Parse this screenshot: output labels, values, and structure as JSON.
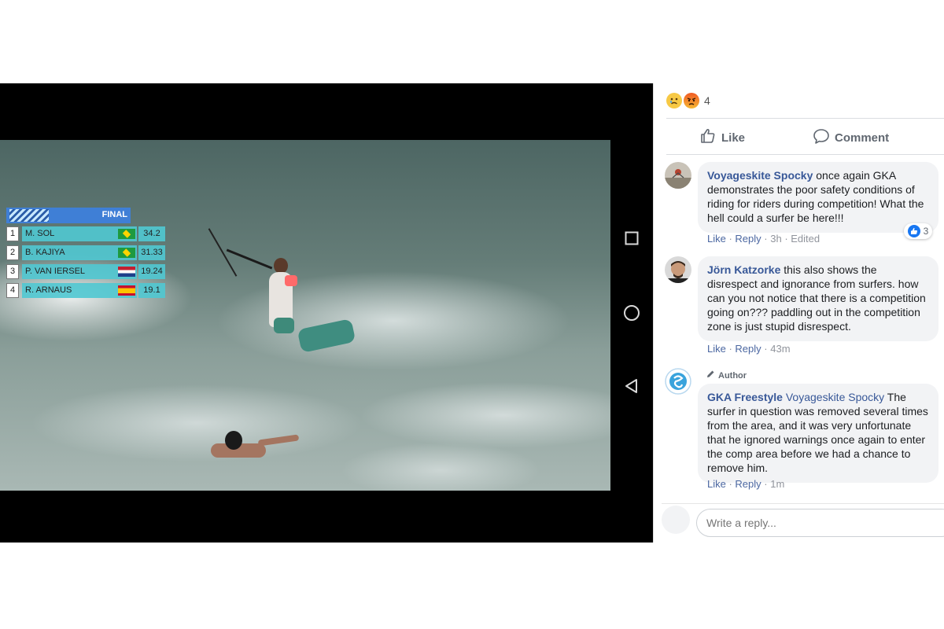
{
  "scoreboard": {
    "round": "FINAL",
    "rows": [
      {
        "pos": "1",
        "name": "M. SOL",
        "score": "34.2",
        "flag": "brazil-flag-icon"
      },
      {
        "pos": "2",
        "name": "B. KAJIYA",
        "score": "31.33",
        "flag": "brazil-flag-icon"
      },
      {
        "pos": "3",
        "name": "P. VAN IERSEL",
        "score": "19.24",
        "flag": "netherlands-flag-icon"
      },
      {
        "pos": "4",
        "name": "R. ARNAUS",
        "score": "19.1",
        "flag": "spain-flag-icon"
      }
    ]
  },
  "nav": {
    "icons": [
      "square-icon",
      "circle-icon",
      "triangle-back-icon"
    ]
  },
  "post": {
    "reaction_count": "4",
    "reactions": [
      "sad-emoji-icon",
      "angry-emoji-icon"
    ],
    "like_label": "Like",
    "comment_label": "Comment"
  },
  "comments": [
    {
      "author": "Voyageskite Spocky",
      "text": " once again GKA demonstrates the poor safety conditions of riding for riders during competition! What the hell could a surfer be here!!!",
      "like": "Like",
      "reply": "Reply",
      "time": "3h",
      "edited": "Edited",
      "like_count": "3"
    },
    {
      "author": "Jörn Katzorke",
      "text": " this also shows the disrespect and ignorance from surfers. how can you not notice that there is a competition going on??? paddling out in the competition zone is just stupid disrespect.",
      "like": "Like",
      "reply": "Reply",
      "time": "43m"
    },
    {
      "author_tag": "Author",
      "author": "GKA Freestyle",
      "mention": "Voyageskite Spocky",
      "text": " The surfer in question was removed several times from the area, and it was very unfortunate that he ignored warnings once again to enter the comp area before we had a chance to remove him.",
      "like": "Like",
      "reply": "Reply",
      "time": "1m"
    }
  ],
  "reply": {
    "placeholder": "Write a reply..."
  }
}
